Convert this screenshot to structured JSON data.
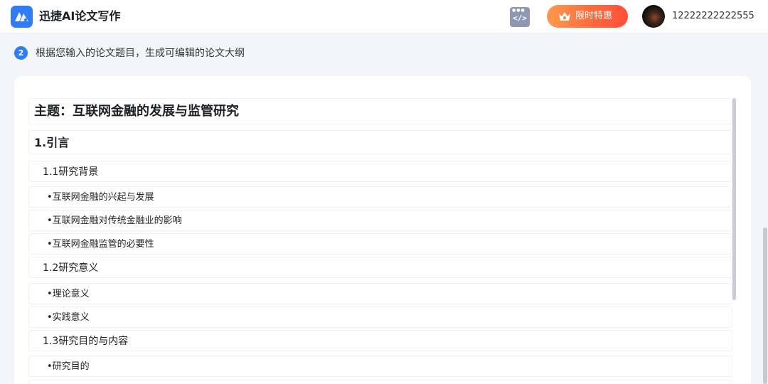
{
  "header": {
    "app_title": "迅捷AI论文写作",
    "promo_label": "限时特惠",
    "username": "12222222222555",
    "code_icon": "code-window-icon",
    "promo_icon": "crown-icon",
    "logo_icon": "app-logo-icon"
  },
  "step": {
    "number": "2",
    "text": "根据您输入的论文题目，生成可编辑的论文大纲"
  },
  "outline": {
    "title": "主题：互联网金融的发展与监管研究",
    "items": [
      {
        "level": "h1",
        "text": "1.引言"
      },
      {
        "level": "h2",
        "text": "1.1研究背景"
      },
      {
        "level": "bullet",
        "text": "•互联网金融的兴起与发展"
      },
      {
        "level": "bullet",
        "text": "•互联网金融对传统金融业的影响"
      },
      {
        "level": "bullet",
        "text": "•互联网金融监管的必要性"
      },
      {
        "level": "h2",
        "text": "1.2研究意义"
      },
      {
        "level": "bullet",
        "text": "•理论意义"
      },
      {
        "level": "bullet",
        "text": "•实践意义"
      },
      {
        "level": "h2",
        "text": "1.3研究目的与内容"
      },
      {
        "level": "bullet",
        "text": "•研究目的"
      }
    ]
  },
  "colors": {
    "brand": "#2f7cf6",
    "promo_start": "#ff9a4d",
    "promo_end": "#ff4f3a",
    "page_bg": "#f3f5fa"
  }
}
